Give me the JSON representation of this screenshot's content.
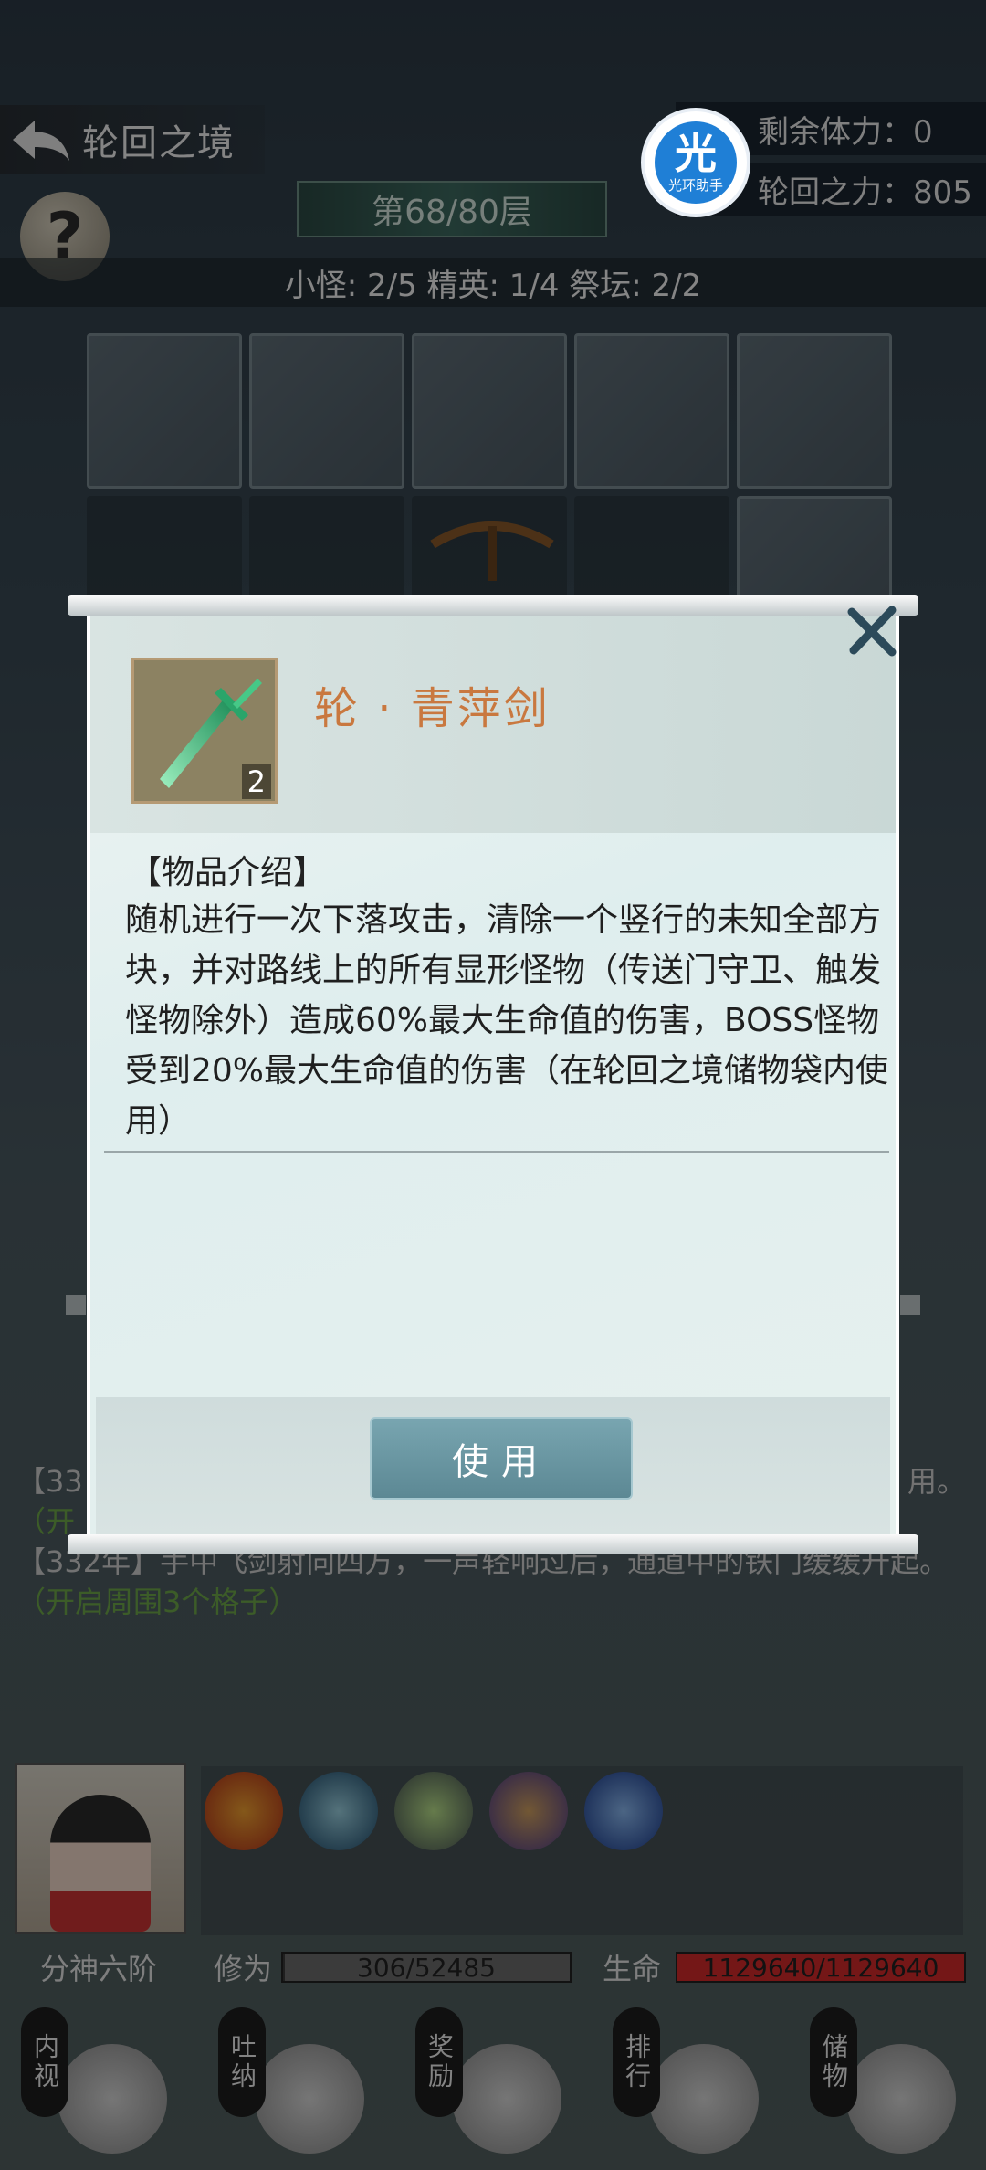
{
  "header": {
    "title": "轮回之境",
    "floor": "第68/80层",
    "stats_line": "小怪: 2/5 精英: 1/4 祭坛: 2/2",
    "stamina": "剩余体力：0",
    "samsara_power": "轮回之力：805"
  },
  "helper_badge": {
    "glyph": "光",
    "label": "光环助手"
  },
  "log": {
    "line1_prefix": "【33",
    "line1_suffix": "用。",
    "line1_hint": "（开",
    "line2": "【332年】手中飞剑射向四方，一声轻响过后，通道中的铁门缓缓升起。",
    "line2_hint": "（开启周围3个格子）"
  },
  "player": {
    "realm": "分神六阶",
    "cultivation_label": "修为",
    "cultivation_value": "306/52485",
    "cultivation_fraction": 0.0058,
    "hp_label": "生命",
    "hp_value": "1129640/1129640",
    "hp_fraction": 1.0
  },
  "nav": [
    {
      "label": "内视",
      "icon": "eye-icon"
    },
    {
      "label": "吐纳",
      "icon": "meditation-icon"
    },
    {
      "label": "奖励",
      "icon": "gift-icon"
    },
    {
      "label": "排行",
      "icon": "ranking-icon"
    },
    {
      "label": "储物",
      "icon": "bag-icon"
    }
  ],
  "modal": {
    "item_name": "轮 · 青萍剑",
    "item_count": "2",
    "item_icon": "jade-sword-icon",
    "desc_title": "【物品介绍】",
    "desc_body": "随机进行一次下落攻击，清除一个竖行的未知全部方块，并对路线上的所有显形怪物（传送门守卫、触发怪物除外）造成60%最大生命值的伤害，BOSS怪物受到20%最大生命值的伤害（在轮回之境储物袋内使用）",
    "use_button": "使用"
  },
  "colors": {
    "accent_item_name": "#c9783f",
    "use_button": "#6a98a3",
    "hp_bar": "#d42a2a",
    "cultivation_bar": "#5a5a5a"
  }
}
